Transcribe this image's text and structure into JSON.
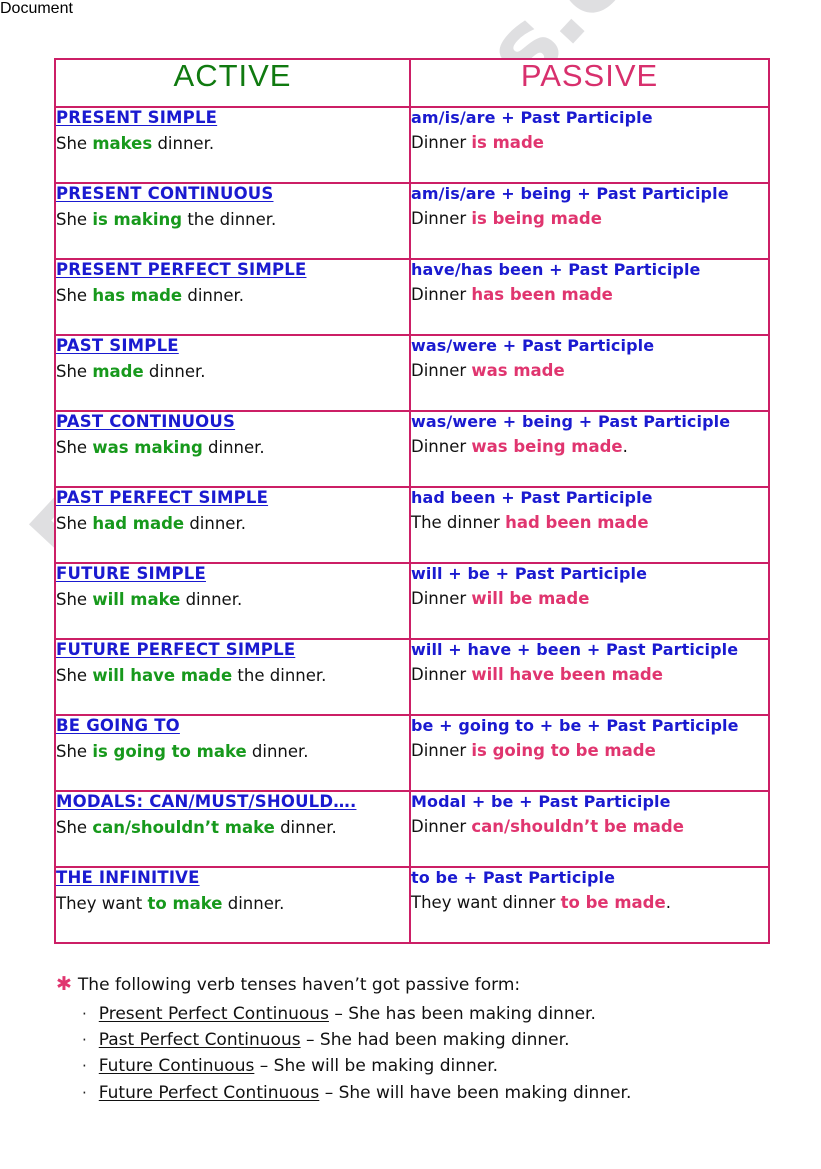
{
  "watermark": {
    "text": "ESLprintables.com"
  },
  "colors": {
    "border": "#cc1f66",
    "active_title": "#107a10",
    "passive_title": "#d8306d",
    "tense_name": "#1a1ad0",
    "formula": "#1a1ad0",
    "highlight_green": "#17991c",
    "highlight_pink": "#e0356f",
    "body_text": "#111111"
  },
  "table": {
    "headers": {
      "active": "ACTIVE",
      "passive": "PASSIVE"
    },
    "rows": [
      {
        "tense": "PRESENT SIMPLE",
        "active_pre": "She ",
        "active_hl": "makes",
        "active_post": " dinner.",
        "formula": "am/is/are + Past Participle",
        "passive_pre": "Dinner ",
        "passive_hl": "is made",
        "passive_post": ""
      },
      {
        "tense": "PRESENT CONTINUOUS",
        "active_pre": "She ",
        "active_hl": "is making",
        "active_post": " the dinner.",
        "formula": "am/is/are + being + Past Participle",
        "passive_pre": "Dinner ",
        "passive_hl": "is being made",
        "passive_post": ""
      },
      {
        "tense": "PRESENT PERFECT SIMPLE",
        "active_pre": "She ",
        "active_hl": "has made",
        "active_post": "  dinner.",
        "formula": "have/has been + Past Participle",
        "passive_pre": "Dinner ",
        "passive_hl": "has been made",
        "passive_post": ""
      },
      {
        "tense": "PAST SIMPLE",
        "active_pre": "She ",
        "active_hl": "made",
        "active_post": "   dinner.",
        "formula": "was/were + Past Participle",
        "passive_pre": "Dinner ",
        "passive_hl": "was made",
        "passive_post": ""
      },
      {
        "tense": "PAST CONTINUOUS",
        "active_pre": "She ",
        "active_hl": "was making",
        "active_post": "  dinner.",
        "formula": "was/were + being + Past Participle",
        "passive_pre": "Dinner ",
        "passive_hl": "was being made",
        "passive_post": "."
      },
      {
        "tense": "PAST PERFECT SIMPLE",
        "active_pre": "She ",
        "active_hl": "had made",
        "active_post": "  dinner.",
        "formula": "had been + Past Participle",
        "passive_pre": "The dinner ",
        "passive_hl": "had been made",
        "passive_post": ""
      },
      {
        "tense": "FUTURE SIMPLE",
        "active_pre": "She ",
        "active_hl": "will make",
        "active_post": "  dinner.",
        "formula": "will + be + Past Participle",
        "passive_pre": "Dinner ",
        "passive_hl": "will be made",
        "passive_post": ""
      },
      {
        "tense": "FUTURE PERFECT SIMPLE",
        "active_pre": "She ",
        "active_hl": "will have made",
        "active_post": " the dinner.",
        "formula": "will + have + been + Past Participle",
        "passive_pre": "Dinner ",
        "passive_hl": "will have been made",
        "passive_post": ""
      },
      {
        "tense": "BE GOING TO",
        "active_pre": "She ",
        "active_hl": "is going to make",
        "active_post": " dinner.",
        "formula": "be + going to + be + Past Participle",
        "passive_pre": "Dinner ",
        "passive_hl": "is going to be made",
        "passive_post": ""
      },
      {
        "tense": "MODALS: CAN/MUST/SHOULD….",
        "active_pre": "She ",
        "active_hl": "can/shouldn’t make",
        "active_post": "  dinner.",
        "formula": "Modal + be + Past Participle",
        "passive_pre": "Dinner ",
        "passive_hl": "can/shouldn’t be made",
        "passive_post": ""
      },
      {
        "tense": "THE INFINITIVE",
        "active_pre": "They want ",
        "active_hl": "to make",
        "active_post": " dinner.",
        "formula": "to be + Past Participle",
        "passive_pre": "They want dinner ",
        "passive_hl": "to be made",
        "passive_post": "."
      }
    ]
  },
  "notes": {
    "asterisk": "✱",
    "heading": "The following verb tenses haven’t got passive form:",
    "bullet": "·",
    "items": [
      {
        "tense": "Present Perfect Continuous",
        "example": " – She has been making dinner."
      },
      {
        "tense": "Past Perfect Continuous",
        "example": " – She had been making dinner."
      },
      {
        "tense": "Future Continuous",
        "example": " – She will be making dinner."
      },
      {
        "tense": "Future Perfect Continuous",
        "example": " – She will have been making dinner."
      }
    ]
  }
}
